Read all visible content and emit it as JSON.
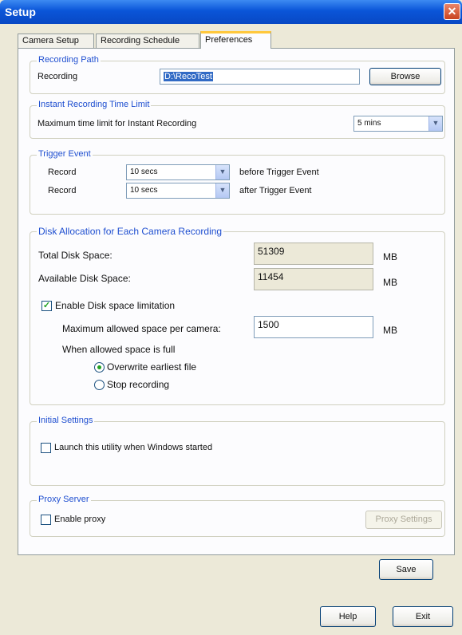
{
  "window": {
    "title": "Setup",
    "close_glyph": "✕"
  },
  "tabs": [
    {
      "label": "Camera Setup"
    },
    {
      "label": "Recording Schedule"
    },
    {
      "label": "Preferences"
    }
  ],
  "recording_path": {
    "group_label": "Recording Path",
    "label": "Recording",
    "value": "D:\\RecoTest",
    "browse_label": "Browse"
  },
  "instant_limit": {
    "group_label": "Instant Recording Time Limit",
    "label": "Maximum time limit for Instant Recording",
    "value": "5 mins"
  },
  "trigger": {
    "group_label": "Trigger Event",
    "row1_label": "Record",
    "row1_value": "10 secs",
    "row1_suffix": "before Trigger Event",
    "row2_label": "Record",
    "row2_value": "10 secs",
    "row2_suffix": "after Trigger Event"
  },
  "disk": {
    "group_label": "Disk Allocation for Each Camera Recording",
    "total_label": "Total Disk Space:",
    "total_value": "51309",
    "available_label": "Available Disk Space:",
    "available_value": "11454",
    "unit": "MB",
    "enable_limit_label": "Enable Disk space limitation",
    "enable_limit_checked": true,
    "max_label": "Maximum allowed space per camera:",
    "max_value": "1500",
    "when_full_label": "When allowed space is full",
    "overwrite_label": "Overwrite earliest file",
    "stop_label": "Stop recording",
    "selected_option": "overwrite"
  },
  "initial": {
    "group_label": "Initial Settings",
    "launch_label": "Launch this utility when Windows started",
    "launch_checked": false
  },
  "proxy": {
    "group_label": "Proxy Server",
    "enable_label": "Enable proxy",
    "enable_checked": false,
    "settings_label": "Proxy Settings"
  },
  "buttons": {
    "save": "Save",
    "help": "Help",
    "exit": "Exit"
  },
  "icons": {
    "dropdown": "chevron-down-icon",
    "check": "checkmark-icon"
  },
  "colors": {
    "title_bar": "#0a55d8",
    "group_label": "#1f4fd0",
    "active_tab_accent": "#ffc83c"
  }
}
